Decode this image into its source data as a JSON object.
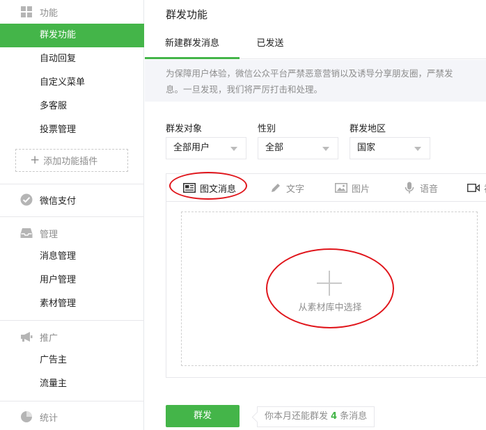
{
  "sidebar": {
    "groups": [
      {
        "title": "功能",
        "icon": "grid-icon"
      },
      {
        "title": "微信支付",
        "icon": "wechat-pay-icon"
      },
      {
        "title": "管理",
        "icon": "inbox-icon"
      },
      {
        "title": "推广",
        "icon": "megaphone-icon"
      },
      {
        "title": "统计",
        "icon": "pie-chart-icon"
      }
    ],
    "function_items": [
      "群发功能",
      "自动回复",
      "自定义菜单",
      "多客服",
      "投票管理"
    ],
    "add_plugin_label": "添加功能插件",
    "manage_items": [
      "消息管理",
      "用户管理",
      "素材管理"
    ],
    "promote_items": [
      "广告主",
      "流量主"
    ]
  },
  "main": {
    "title": "群发功能",
    "tabs": [
      "新建群发消息",
      "已发送"
    ],
    "notice": {
      "line1": "为保障用户体验，微信公众平台严禁恶意营销以及诱导分享朋友圈，严禁发",
      "line2": "息。一旦发现，我们将严厉打击和处理。"
    },
    "filters": [
      {
        "label": "群发对象",
        "value": "全部用户"
      },
      {
        "label": "性别",
        "value": "全部"
      },
      {
        "label": "群发地区",
        "value": "国家"
      }
    ],
    "message_types": [
      {
        "label": "图文消息",
        "icon": "news-icon"
      },
      {
        "label": "文字",
        "icon": "pencil-icon"
      },
      {
        "label": "图片",
        "icon": "image-icon"
      },
      {
        "label": "语音",
        "icon": "microphone-icon"
      },
      {
        "label": "视",
        "icon": "video-icon"
      }
    ],
    "drop_text": "从素材库中选择",
    "send_label": "群发",
    "quota": {
      "prefix": "你本月还能群发",
      "count": "4",
      "suffix": "条消息"
    }
  },
  "colors": {
    "accent": "#44b549",
    "annotation": "#e0151b",
    "notice_bg": "#f4f5f9"
  }
}
